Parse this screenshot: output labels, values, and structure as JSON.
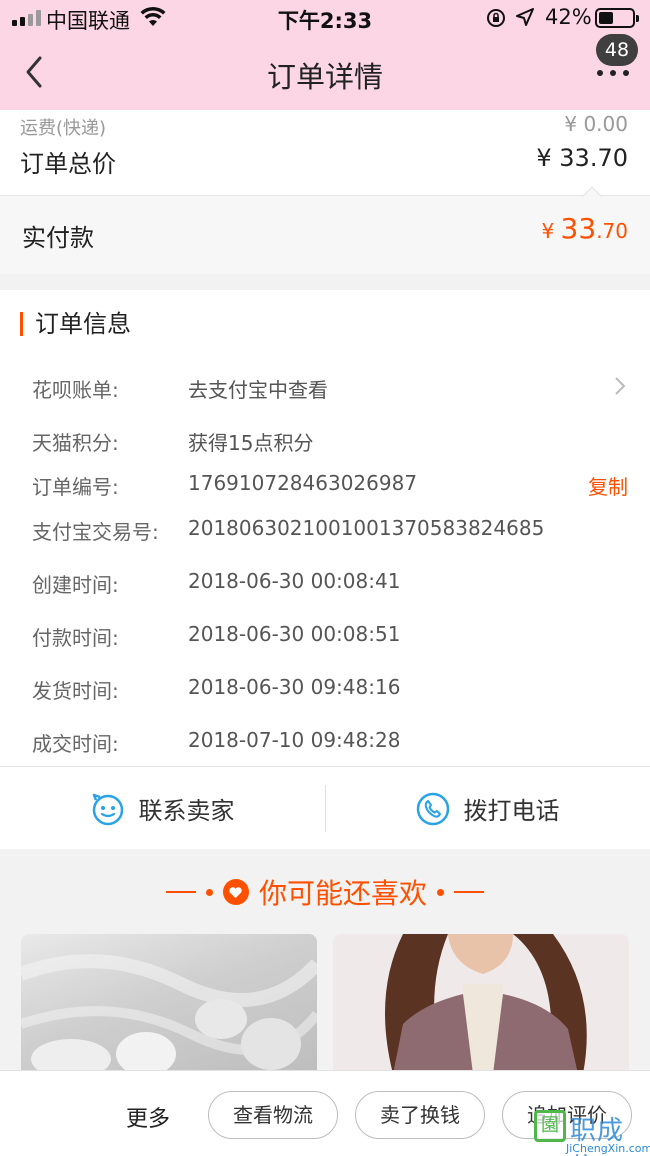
{
  "status_bar": {
    "carrier": "中国联通",
    "time": "下午2:33",
    "battery": "42%"
  },
  "nav": {
    "title": "订单详情",
    "badge": "48"
  },
  "price": {
    "shipping_label": "运费(快递)",
    "shipping_value": "¥ 0.00",
    "total_label": "订单总价",
    "total_value": "¥ 33.70",
    "paid_label": "实付款",
    "paid_currency": "¥ ",
    "paid_int": "33",
    "paid_dec": ".70"
  },
  "order_info": {
    "heading": "订单信息",
    "rows": [
      {
        "key": "花呗账单:",
        "value": "去支付宝中查看"
      },
      {
        "key": "天猫积分:",
        "value": "获得15点积分"
      },
      {
        "key": "订单编号:",
        "value": "176910728463026987",
        "action": "复制"
      },
      {
        "key": "支付宝交易号:",
        "value": "2018063021001001370583824685"
      },
      {
        "key": "创建时间:",
        "value": "2018-06-30 00:08:41"
      },
      {
        "key": "付款时间:",
        "value": "2018-06-30 00:08:51"
      },
      {
        "key": "发货时间:",
        "value": "2018-06-30 09:48:16"
      },
      {
        "key": "成交时间:",
        "value": "2018-07-10 09:48:28"
      }
    ]
  },
  "contact": {
    "seller": "联系卖家",
    "phone": "拨打电话"
  },
  "recommend": {
    "title": "你可能还喜欢"
  },
  "bottom_bar": {
    "more": "更多",
    "logistics": "查看物流",
    "sell": "卖了换钱",
    "review": "追加评价"
  },
  "watermark": {
    "cn": "职成信",
    "en": "JiChengXin.com"
  },
  "colors": {
    "accent": "#ff5000",
    "nav_bg": "#fcd6e4",
    "icon_blue": "#2aa2e6"
  }
}
